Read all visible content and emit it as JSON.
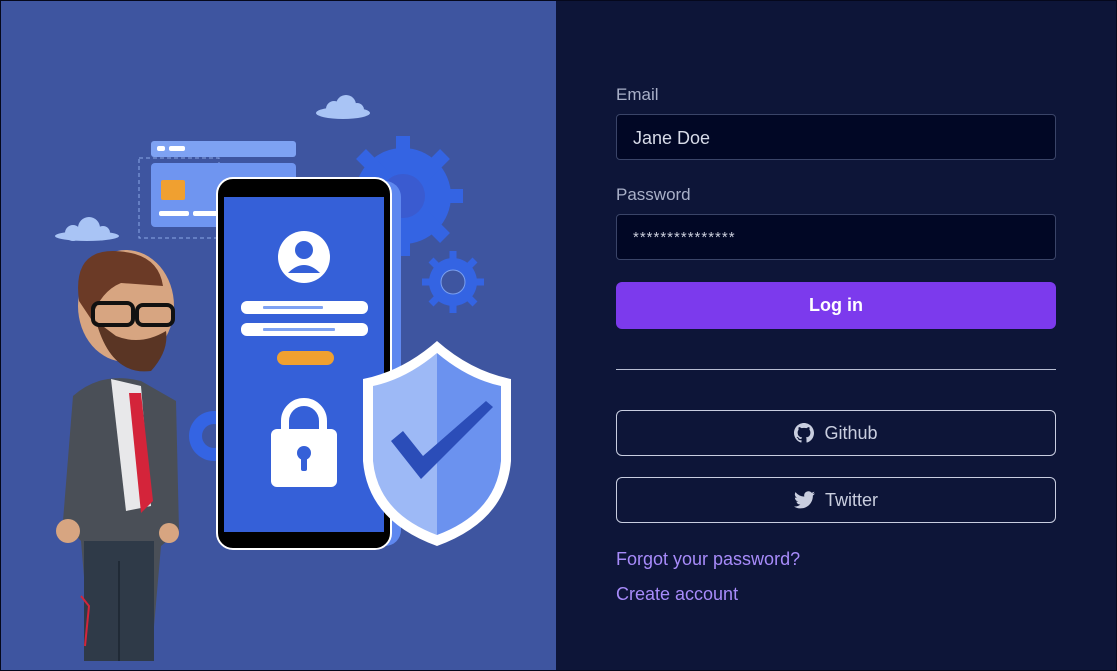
{
  "form": {
    "email_label": "Email",
    "email_value": "Jane Doe",
    "password_label": "Password",
    "password_value": "***************",
    "login_label": "Log in"
  },
  "social": {
    "github_label": "Github",
    "github_icon": "github-icon",
    "twitter_label": "Twitter",
    "twitter_icon": "twitter-icon"
  },
  "links": {
    "forgot_password": "Forgot your password?",
    "create_account": "Create account"
  },
  "colors": {
    "left_bg": "#3e55a0",
    "right_bg": "#0d1538",
    "accent": "#7c3aed",
    "link": "#a78bfa"
  }
}
